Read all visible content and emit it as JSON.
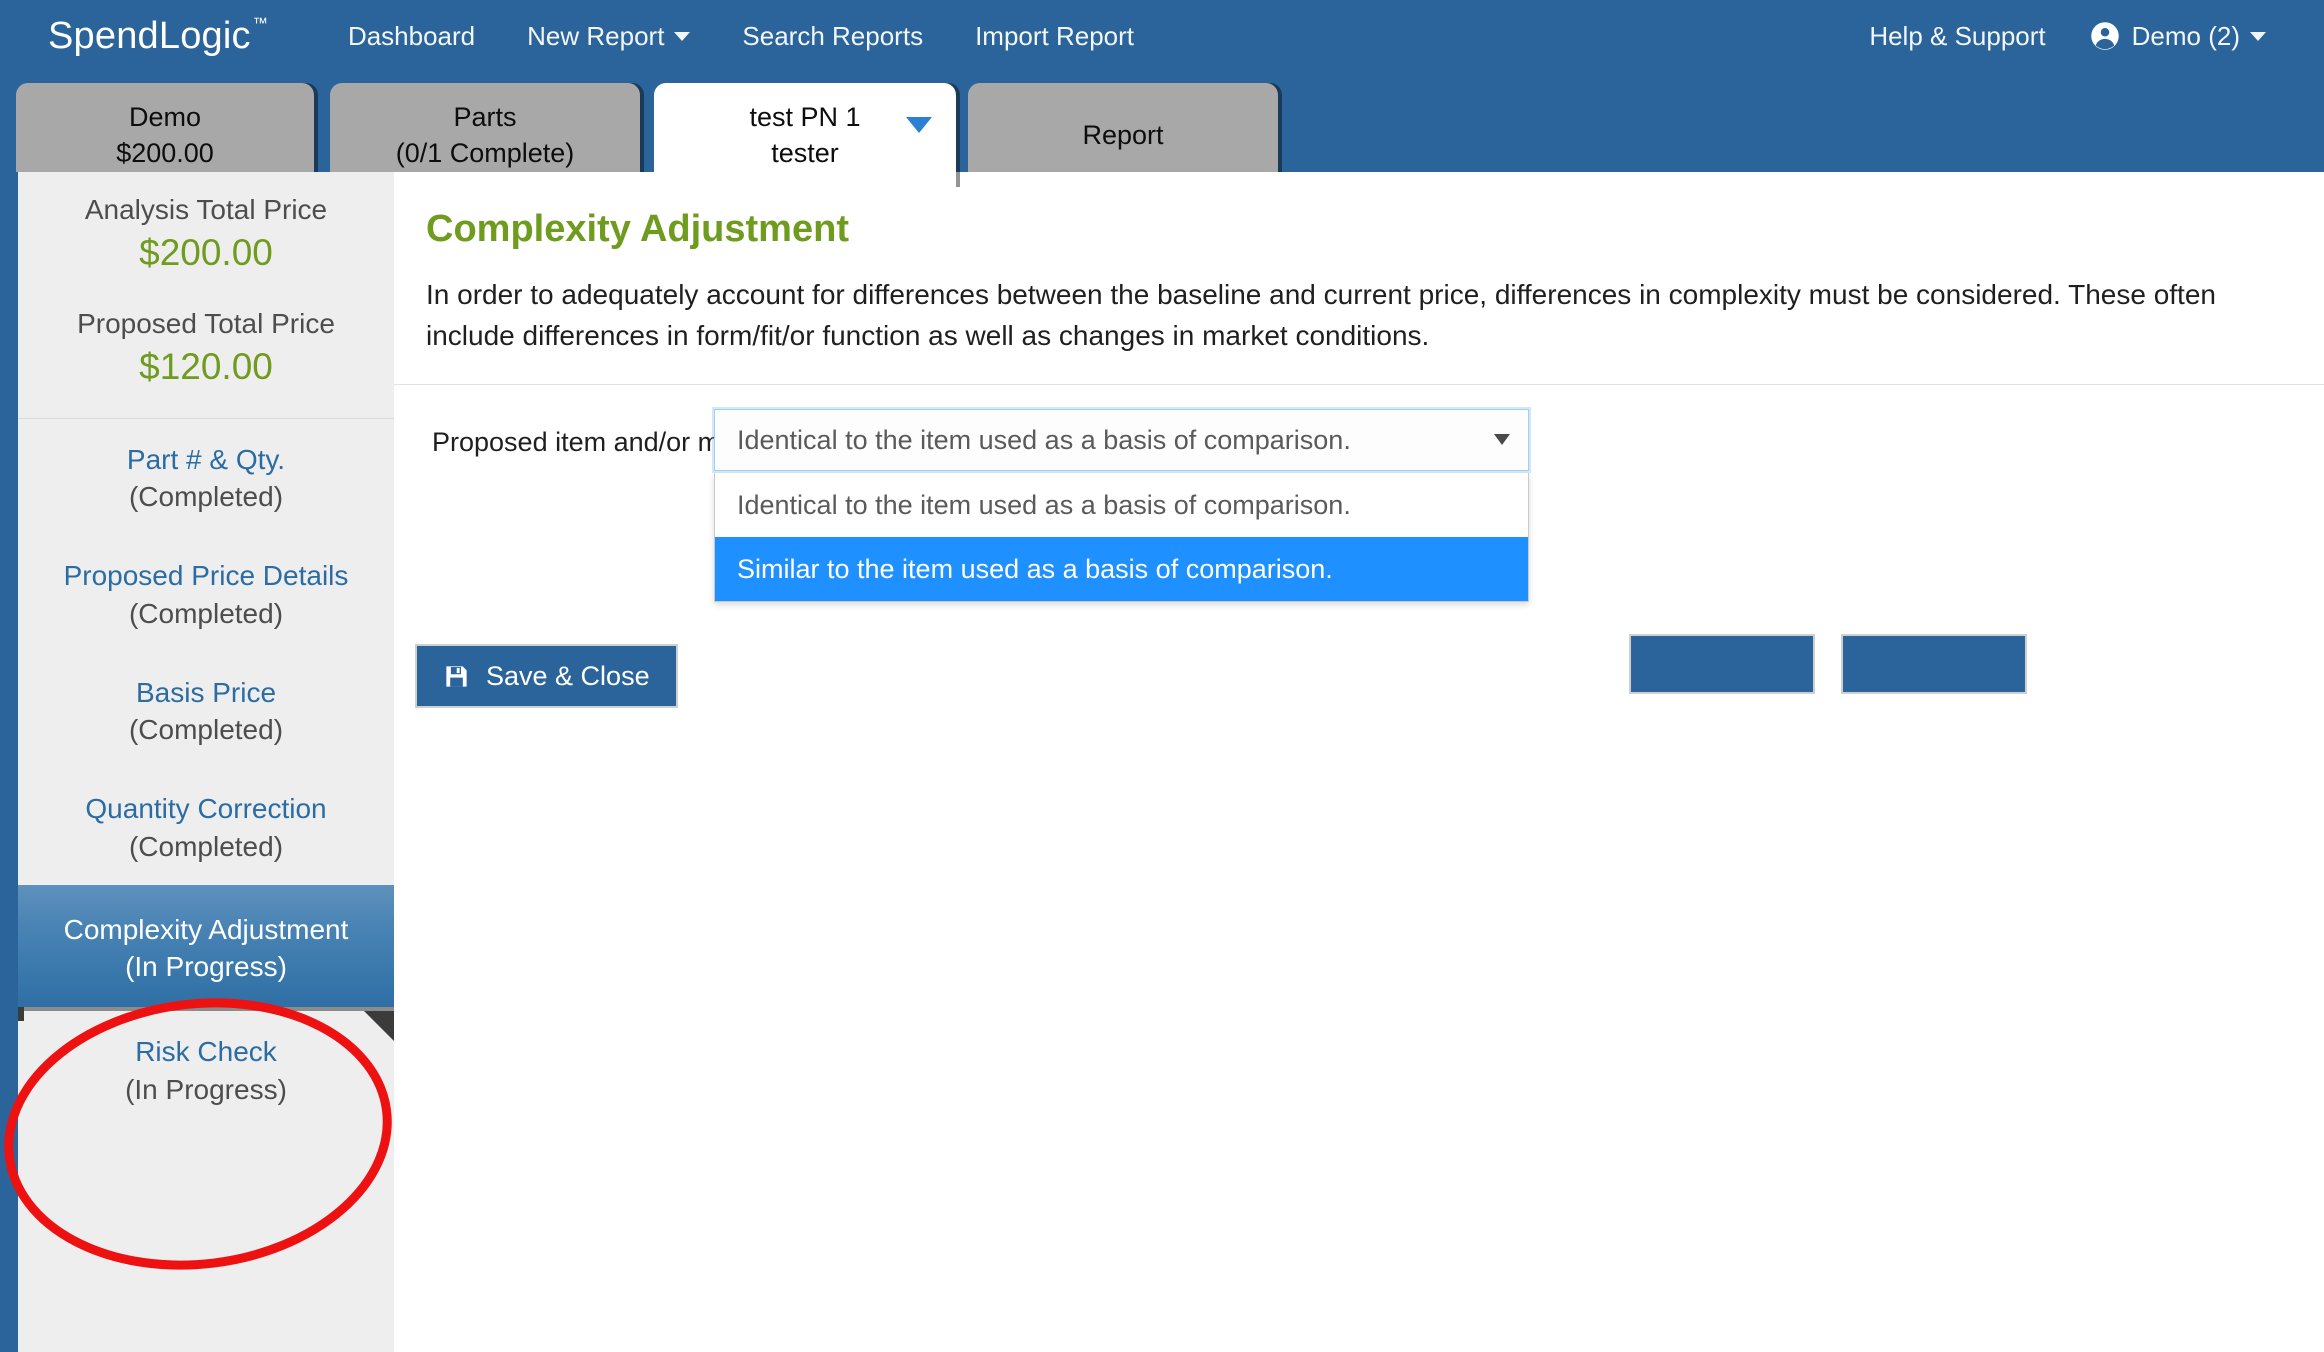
{
  "navbar": {
    "brand": "SpendLogic",
    "brand_tm": "™",
    "links": [
      {
        "label": "Dashboard",
        "icon": ""
      },
      {
        "label": "New Report",
        "icon": "chevron-down-icon"
      },
      {
        "label": "Search Reports",
        "icon": ""
      },
      {
        "label": "Import Report",
        "icon": ""
      }
    ],
    "right": {
      "help": "Help & Support",
      "user_icon": "account-circle-icon",
      "user": "Demo (2)",
      "user_caret": "chevron-down-icon"
    },
    "background_color": "#2b649a"
  },
  "tabs": [
    {
      "line1": "Demo",
      "line2": "$200.00",
      "active": false,
      "has_caret": false
    },
    {
      "line1": "Parts",
      "line2": "(0/1 Complete)",
      "active": false,
      "has_caret": false
    },
    {
      "line1": "test PN 1",
      "line2": "tester",
      "active": true,
      "has_caret": true
    },
    {
      "line1": "Report",
      "line2": "",
      "active": false,
      "has_caret": false
    }
  ],
  "sidebar": {
    "prices": [
      {
        "label": "Analysis Total Price",
        "value": "$200.00"
      },
      {
        "label": "Proposed Total Price",
        "value": "$120.00"
      }
    ],
    "items": [
      {
        "title": "Part # & Qty.",
        "status": "(Completed)",
        "active": false
      },
      {
        "title": "Proposed Price Details",
        "status": "(Completed)",
        "active": false
      },
      {
        "title": "Basis Price",
        "status": "(Completed)",
        "active": false
      },
      {
        "title": "Quantity Correction",
        "status": "(Completed)",
        "active": false
      },
      {
        "title": "Complexity Adjustment",
        "status": "(In Progress)",
        "active": true
      },
      {
        "title": "Risk Check",
        "status": "(In Progress)",
        "active": false
      }
    ],
    "price_value_color": "#6f9b1f",
    "link_color": "#2b6ca3",
    "active_bg_color": "#3b7cae"
  },
  "main": {
    "title": "Complexity Adjustment",
    "title_color": "#6f9b1f",
    "description": "In order to adequately account for differences between the baseline and current price, differences in complexity must be considered. These often include differences in form/fit/or function as well as changes in market conditions.",
    "form": {
      "label": "Proposed item and/or market conditions are:",
      "info_icon": "info-circle-icon",
      "select": {
        "value": "Identical to the item used as a basis of comparison.",
        "arrow_icon": "chevron-down-icon",
        "expanded": true,
        "options": [
          {
            "label": "Identical to the item used as a basis of comparison.",
            "highlighted": false
          },
          {
            "label": "Similar to the item used as a basis of comparison.",
            "highlighted": true
          }
        ],
        "highlight_color": "#1e90ff"
      }
    },
    "save_button": {
      "label": "Save & Close",
      "icon": "floppy-save-icon"
    }
  },
  "annotation": {
    "shape": "red-ellipse",
    "color": "#ee1111",
    "target": "Complexity Adjustment (In Progress)"
  }
}
